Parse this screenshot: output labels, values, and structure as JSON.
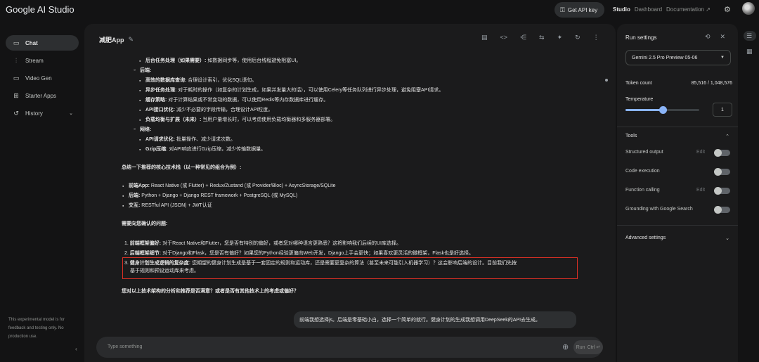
{
  "topbar": {
    "logo": "Google AI Studio",
    "api_key_label": "Get API key",
    "links": [
      "Studio",
      "Dashboard",
      "Documentation"
    ]
  },
  "sidebar": {
    "items": [
      {
        "label": "Chat",
        "icon": "chat-icon"
      },
      {
        "label": "Stream",
        "icon": "stream-icon"
      },
      {
        "label": "Video Gen",
        "icon": "video-icon"
      },
      {
        "label": "Starter Apps",
        "icon": "apps-icon"
      },
      {
        "label": "History",
        "icon": "history-icon"
      }
    ],
    "disclaimer": "This experimental model is for feedback and testing only. No production use."
  },
  "main": {
    "title": "减肥App",
    "lines": [
      {
        "style": "filled",
        "bold": "后台任务处理（如果需要）:",
        "text": "如数据同步等，使用后台线程避免阻塞UI。"
      },
      {
        "style": "open",
        "bold": "后端:",
        "text": ""
      },
      {
        "style": "filled",
        "bold": "高效的数据库查询:",
        "text": "合理设计索引，优化SQL语句。"
      },
      {
        "style": "filled",
        "bold": "异步任务处理:",
        "text": "对于耗时的操作（如复杂的计划生成，如果并发量大的话），可以使用Celery等任务队列进行异步处理，避免阻塞API请求。"
      },
      {
        "style": "filled",
        "bold": "缓存策略:",
        "text": "对于计算结果或不常变动的数据，可以使用Redis等内存数据库进行缓存。"
      },
      {
        "style": "filled",
        "bold": "API接口优化:",
        "text": "减少不必要的字段传输，合理设计API粒度。"
      },
      {
        "style": "filled",
        "bold": "负载均衡与扩展（未来）:",
        "text": "当用户量增长时，可以考虑使用负载均衡器和多服务器部署。"
      },
      {
        "style": "open",
        "bold": "网络:",
        "text": ""
      },
      {
        "style": "filled",
        "bold": "API请求优化:",
        "text": "批量操作、减少请求次数。"
      },
      {
        "style": "filled",
        "bold": "Gzip压缩:",
        "text": "对API响应进行Gzip压缩，减少传输数据量。"
      }
    ],
    "summary_heading": "总结一下推荐的核心技术栈（以一种常见的组合为例）:",
    "stack": [
      {
        "bold": "前端App:",
        "text": "React Native (或 Flutter) + Redux/Zustand (或 Provider/Bloc) + AsyncStorage/SQLite"
      },
      {
        "bold": "后端:",
        "text": "Python + Django + Django REST framework + PostgreSQL (或 MySQL)"
      },
      {
        "bold": "交互:",
        "text": "RESTful API (JSON) + JWT认证"
      }
    ],
    "confirm_heading": "需要向您确认的问题:",
    "questions": [
      {
        "num": "1.",
        "bold": "前端框架偏好:",
        "text": "对于React Native和Flutter，您是否有特别的偏好，或者您对哪种语言更熟悉？这将影响我们后续的UI库选择。"
      },
      {
        "num": "2.",
        "bold": "后端框架细节:",
        "text": "对于Django和Flask，您是否有偏好？如果您的Python经验更偏向Web开发，Django上手会更快；如果喜欢更灵活的微框架，Flask也是好选择。"
      },
      {
        "num": "3.",
        "bold": "健身计划生成逻辑的复杂度:",
        "text": "您期望的健身计划生成是基于一套固定的规则和运动库，还是需要更复杂的算法（甚至未来可能引入机器学习）？这会影响后端的设计。目前我们先按",
        "cont": "基于规则和预设运动库来考虑。"
      }
    ],
    "closing": "您对以上技术架构的分析和推荐是否满意？或者是否有其他技术上的考虑或偏好？",
    "user_message": "前端我想选择js。后端是零基础小白，选择一个简单的就行。健身计划的生成我想调用DeepSeek的API去生成。",
    "prompt_placeholder": "Type something",
    "run_label": "Run",
    "run_shortcut": "Ctrl ↵"
  },
  "run_settings": {
    "title": "Run settings",
    "model": "Gemini 2.5 Pro Preview 05-06",
    "token_count_label": "Token count",
    "token_count_value": "85,516 / 1,048,576",
    "temperature_label": "Temperature",
    "temperature_value": "1",
    "temperature_fraction": 0.5,
    "tools_label": "Tools",
    "tools": [
      {
        "label": "Structured output",
        "edit": "Edit"
      },
      {
        "label": "Code execution",
        "edit": ""
      },
      {
        "label": "Function calling",
        "edit": "Edit"
      },
      {
        "label": "Grounding with Google Search",
        "edit": ""
      }
    ],
    "advanced_label": "Advanced settings"
  },
  "colors": {
    "accent": "#8ab4f8",
    "highlight_box": "#d93025"
  }
}
